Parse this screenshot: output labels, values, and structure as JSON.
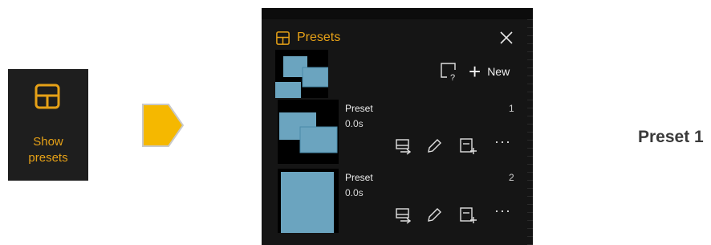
{
  "colors": {
    "accent": "#e6a117",
    "arrow": "#f5b800",
    "panel_bg": "#151515",
    "thumb_blue": "#6ba4bf"
  },
  "show_presets": {
    "line1": "Show",
    "line2": "presets",
    "icon": "layout-grid-icon"
  },
  "panel": {
    "title": "Presets",
    "new_label": "New",
    "icons": [
      "layout-grid-icon",
      "close-icon",
      "question-rect-icon",
      "plus-icon"
    ],
    "presets": [
      {
        "name": "Preset",
        "duration": "0.0s",
        "number": "1"
      },
      {
        "name": "Preset",
        "duration": "0.0s",
        "number": "2"
      }
    ],
    "row_actions": [
      "apply-icon",
      "edit-pencil-icon",
      "save-add-icon",
      "more-icon"
    ],
    "more_label": "···"
  },
  "caption": "Preset 1"
}
